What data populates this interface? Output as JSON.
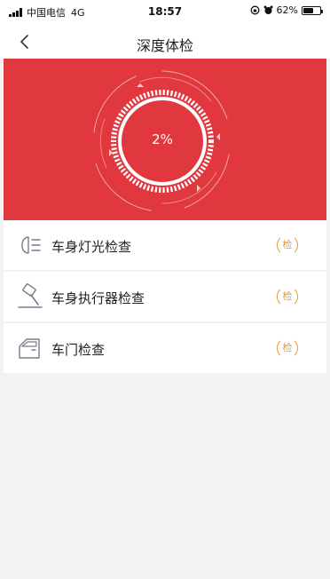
{
  "status_bar": {
    "carrier": "中国电信",
    "network": "4G",
    "time": "18:57",
    "battery": "62%"
  },
  "nav": {
    "title": "深度体检",
    "back_icon": "chevron-left-icon"
  },
  "progress": {
    "value": 2,
    "label": "2%"
  },
  "checks": [
    {
      "label": "车身灯光检查",
      "badge": "检",
      "icon": "headlight-icon"
    },
    {
      "label": "车身执行器检查",
      "badge": "检",
      "icon": "hammer-icon"
    },
    {
      "label": "车门检查",
      "badge": "检",
      "icon": "car-door-icon"
    }
  ],
  "colors": {
    "hero": "#e0383e",
    "badge": "#e89a2e"
  }
}
